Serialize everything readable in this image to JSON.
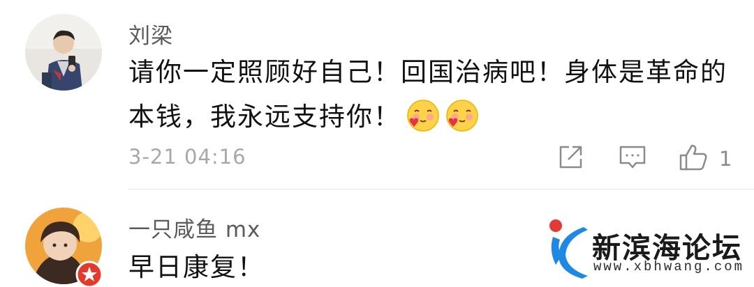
{
  "comments": [
    {
      "username": "刘梁",
      "text": "请你一定照顾好自己！回国治病吧！身体是革命的本钱，我永远支持你！",
      "emojis": [
        "blush-heart-emoji",
        "blush-heart-emoji"
      ],
      "timestamp": "3-21 04:16",
      "like_count": "1"
    },
    {
      "username": "一只咸鱼 mx",
      "text": "早日康复！"
    }
  ],
  "watermark": {
    "name": "新滨海论坛",
    "url": "www.xbhwang.com"
  },
  "colors": {
    "username": "#5a5a5a",
    "body": "#111111",
    "timestamp": "#a8a8a8",
    "icon": "#8a8a8a",
    "logo_blue": "#1e88e5",
    "logo_red": "#e53935"
  }
}
